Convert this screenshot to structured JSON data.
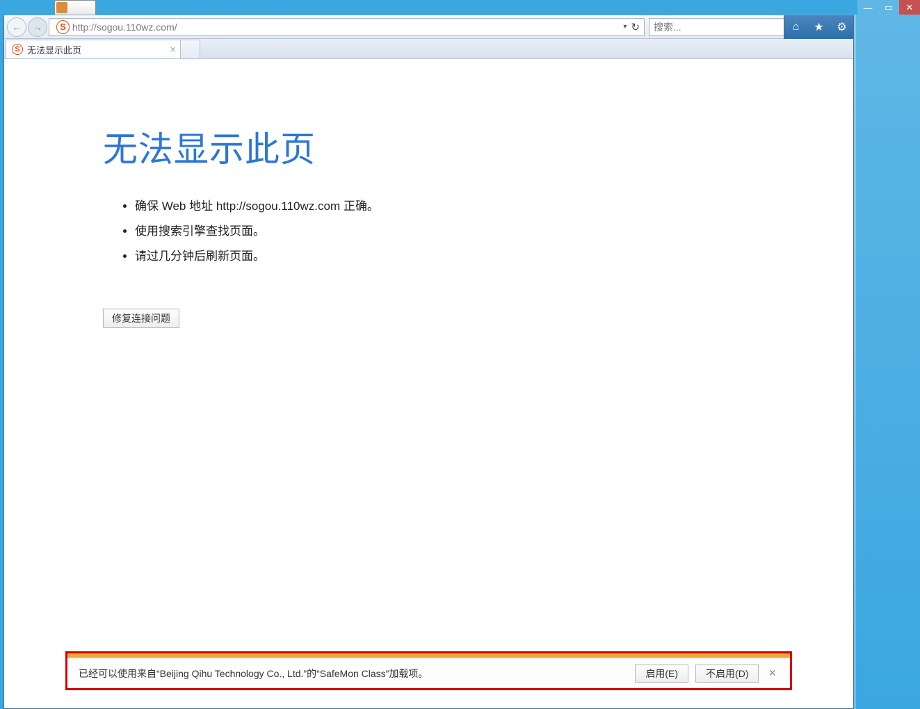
{
  "window": {
    "minimize_glyph": "—",
    "maximize_glyph": "▭",
    "close_glyph": "✕"
  },
  "nav": {
    "back_glyph": "←",
    "forward_glyph": "→",
    "site_icon_letter": "S",
    "url": "http://sogou.110wz.com/",
    "dropdown_glyph": "▾",
    "refresh_glyph": "↻",
    "search_placeholder": "搜索...",
    "search_glyph": "🔍",
    "search_dd_glyph": "▾",
    "home_glyph": "⌂",
    "star_glyph": "★",
    "gear_glyph": "⚙"
  },
  "tabs": {
    "active": {
      "title": "无法显示此页",
      "fav_letter": "S",
      "close_glyph": "×"
    }
  },
  "error": {
    "heading": "无法显示此页",
    "bullets": [
      "确保 Web 地址 http://sogou.110wz.com 正确。",
      "使用搜索引擎查找页面。",
      "请过几分钟后刷新页面。"
    ],
    "fix_button": "修复连接问题"
  },
  "notif": {
    "text": "已经可以使用来自“Beijing Qihu Technology Co., Ltd.”的“SafeMon Class”加载项。",
    "enable": "启用(E)",
    "disable": "不启用(D)",
    "close_glyph": "×"
  }
}
